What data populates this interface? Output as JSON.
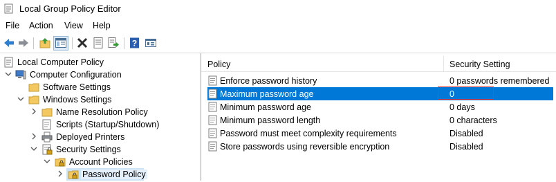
{
  "window": {
    "title": "Local Group Policy Editor"
  },
  "menu": {
    "items": [
      "File",
      "Action",
      "View",
      "Help"
    ]
  },
  "toolbar": {
    "icons": [
      "back-arrow-icon",
      "forward-arrow-icon",
      "up-folder-icon",
      "show-hide-tree-icon",
      "delete-icon",
      "properties-icon",
      "export-list-icon",
      "help-icon",
      "view-icon"
    ]
  },
  "tree": {
    "nodes": [
      {
        "label": "Local Computer Policy"
      },
      {
        "label": "Computer Configuration"
      },
      {
        "label": "Software Settings"
      },
      {
        "label": "Windows Settings"
      },
      {
        "label": "Name Resolution Policy"
      },
      {
        "label": "Scripts (Startup/Shutdown)"
      },
      {
        "label": "Deployed Printers"
      },
      {
        "label": "Security Settings"
      },
      {
        "label": "Account Policies"
      },
      {
        "label": "Password Policy"
      }
    ]
  },
  "list": {
    "columns": {
      "policy": "Policy",
      "setting": "Security Setting"
    },
    "rows": [
      {
        "policy": "Enforce password history",
        "setting": "0 passwords remembered"
      },
      {
        "policy": "Maximum password age",
        "setting": "0"
      },
      {
        "policy": "Minimum password age",
        "setting": "0 days"
      },
      {
        "policy": "Minimum password length",
        "setting": "0 characters"
      },
      {
        "policy": "Password must meet complexity requirements",
        "setting": "Disabled"
      },
      {
        "policy": "Store passwords using reversible encryption",
        "setting": "Disabled"
      }
    ],
    "selected_row": 1
  },
  "colors": {
    "selection": "#0078d7",
    "highlight_box": "#e03030",
    "folder": "#f4c860"
  }
}
